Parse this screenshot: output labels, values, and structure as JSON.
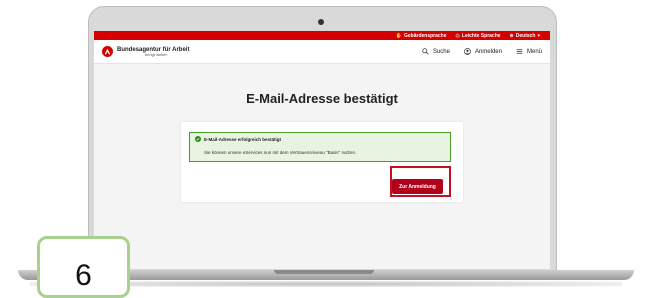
{
  "utility_bar": {
    "items": [
      {
        "icon": "hand-icon",
        "label": "Gebärdensprache"
      },
      {
        "icon": "easy-language-icon",
        "label": "Leichte Sprache"
      },
      {
        "icon": "globe-icon",
        "label": "Deutsch"
      }
    ]
  },
  "header": {
    "brand_name": "Bundesagentur für Arbeit",
    "brand_tagline": "bringt weiter.",
    "search_label": "Suche",
    "login_label": "Anmelden",
    "menu_label": "Menü"
  },
  "main": {
    "title": "E-Mail-Adresse bestätigt",
    "alert": {
      "heading": "E-Mail-Adresse erfolgreich bestätigt",
      "body": "Sie können unsere eServices nun mit dem Vertrauensniveau \"Basis\" nutzen."
    },
    "button_label": "Zur Anmeldung"
  },
  "step": {
    "number": "6"
  },
  "colors": {
    "brand_red": "#d50000",
    "button_red": "#b3001b",
    "success_green": "#2e8b1e",
    "badge_border": "#a9d18e"
  }
}
